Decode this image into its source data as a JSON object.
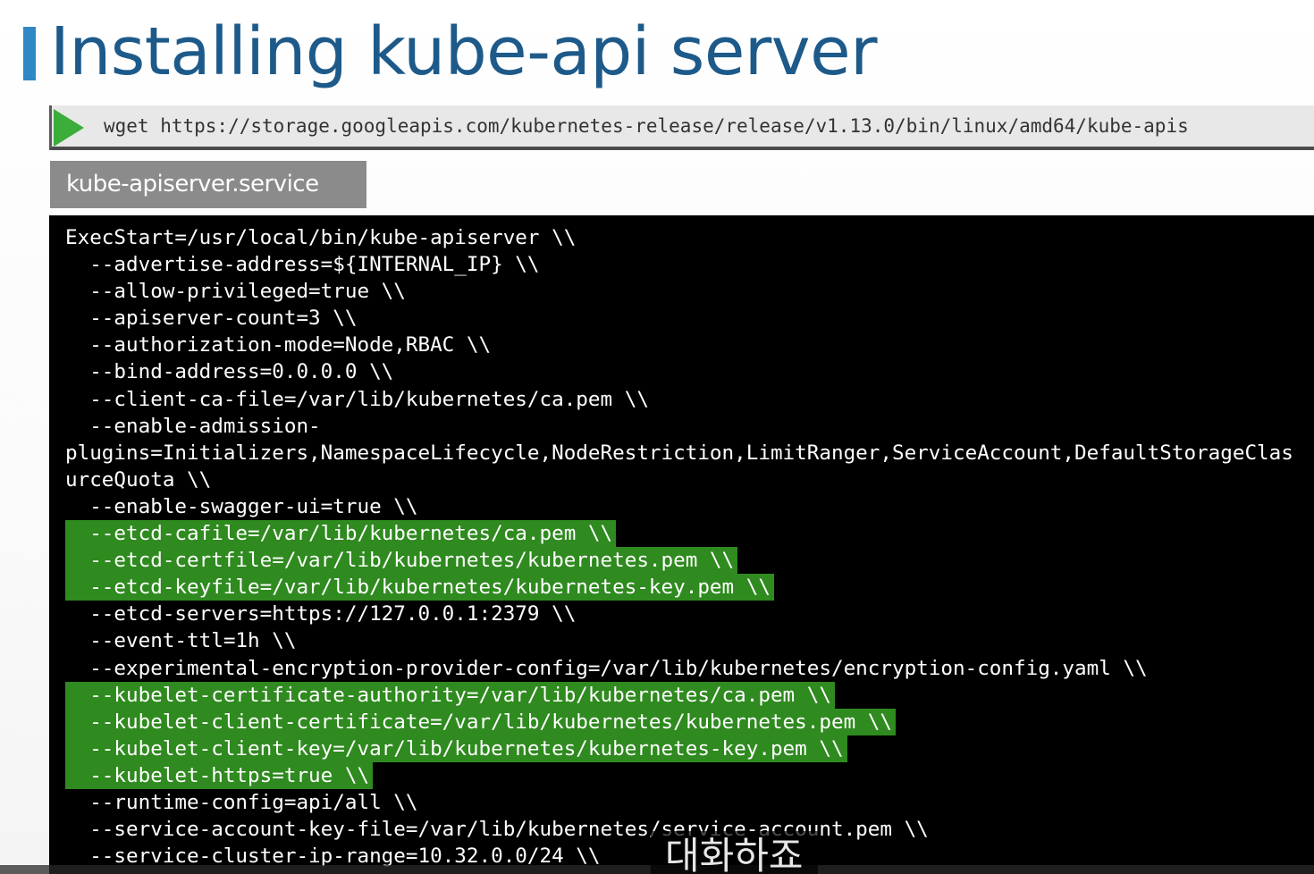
{
  "slide": {
    "title": "Installing kube-api server",
    "accent_color": "#2f87c5",
    "title_color": "#1d5a8a"
  },
  "command": {
    "icon": "play-icon",
    "text": "wget https://storage.googleapis.com/kubernetes-release/release/v1.13.0/bin/linux/amd64/kube-apis"
  },
  "file_label": "kube-apiserver.service",
  "terminal": {
    "highlight_color": "#2f8a1f",
    "lines": [
      {
        "text": "ExecStart=/usr/local/bin/kube-apiserver \\\\",
        "highlight": false
      },
      {
        "text": "  --advertise-address=${INTERNAL_IP} \\\\",
        "highlight": false
      },
      {
        "text": "  --allow-privileged=true \\\\",
        "highlight": false
      },
      {
        "text": "  --apiserver-count=3 \\\\",
        "highlight": false
      },
      {
        "text": "  --authorization-mode=Node,RBAC \\\\",
        "highlight": false
      },
      {
        "text": "  --bind-address=0.0.0.0 \\\\",
        "highlight": false
      },
      {
        "text": "  --client-ca-file=/var/lib/kubernetes/ca.pem \\\\",
        "highlight": false
      },
      {
        "text": "  --enable-admission-",
        "highlight": false
      },
      {
        "text": "plugins=Initializers,NamespaceLifecycle,NodeRestriction,LimitRanger,ServiceAccount,DefaultStorageClas",
        "highlight": false
      },
      {
        "text": "urceQuota \\\\",
        "highlight": false
      },
      {
        "text": "  --enable-swagger-ui=true \\\\",
        "highlight": false
      },
      {
        "text": "  --etcd-cafile=/var/lib/kubernetes/ca.pem \\\\",
        "highlight": true
      },
      {
        "text": "  --etcd-certfile=/var/lib/kubernetes/kubernetes.pem \\\\",
        "highlight": true
      },
      {
        "text": "  --etcd-keyfile=/var/lib/kubernetes/kubernetes-key.pem \\\\",
        "highlight": true
      },
      {
        "text": "  --etcd-servers=https://127.0.0.1:2379 \\\\",
        "highlight": false
      },
      {
        "text": "  --event-ttl=1h \\\\",
        "highlight": false
      },
      {
        "text": "  --experimental-encryption-provider-config=/var/lib/kubernetes/encryption-config.yaml \\\\",
        "highlight": false
      },
      {
        "text": "  --kubelet-certificate-authority=/var/lib/kubernetes/ca.pem \\\\",
        "highlight": true
      },
      {
        "text": "  --kubelet-client-certificate=/var/lib/kubernetes/kubernetes.pem \\\\",
        "highlight": true
      },
      {
        "text": "  --kubelet-client-key=/var/lib/kubernetes/kubernetes-key.pem \\\\",
        "highlight": true
      },
      {
        "text": "  --kubelet-https=true \\\\",
        "highlight": true
      },
      {
        "text": "  --runtime-config=api/all \\\\",
        "highlight": false
      },
      {
        "text": "  --service-account-key-file=/var/lib/kubernetes/service-account.pem \\\\",
        "highlight": false
      },
      {
        "text": "  --service-cluster-ip-range=10.32.0.0/24 \\\\",
        "highlight": false
      }
    ]
  },
  "subtitle": "대화하죠"
}
